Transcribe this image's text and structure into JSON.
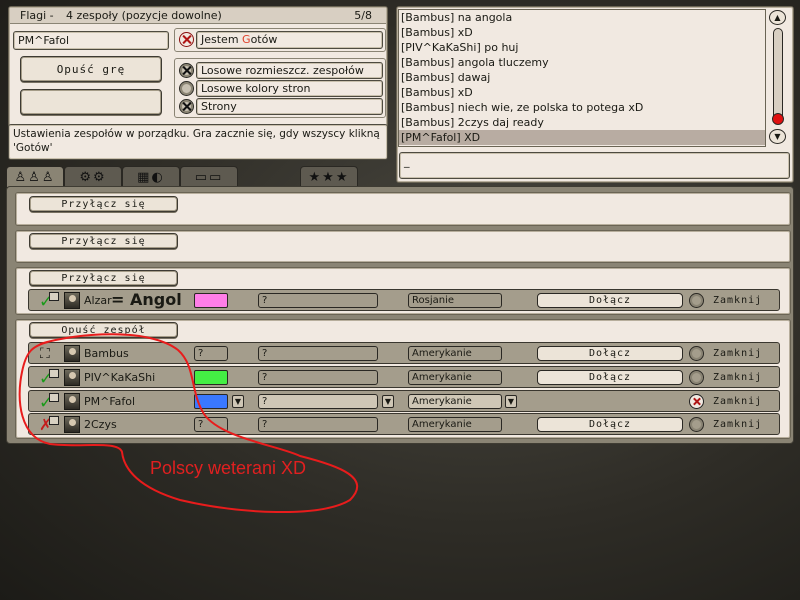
{
  "header": {
    "map_name": "Flagi -",
    "mode": "4 zespoły (pozycje dowolne)",
    "player_count": "5/8"
  },
  "left_panel": {
    "player_name": "PM^Fafol",
    "leave_game_label": "Opuść grę",
    "empty_button_label": "",
    "ready_label": "Jestem Gotów",
    "ready_highlight_char": "G",
    "options": [
      {
        "label": "Losowe rozmieszcz. zespołów",
        "checked": true
      },
      {
        "label": "Losowe kolory stron",
        "checked": false
      },
      {
        "label": "Strony",
        "checked": true
      }
    ],
    "status_message": "Ustawienia zespołów w porządku. Gra zacznie się, gdy wszyscy klikną 'Gotów'"
  },
  "chat": {
    "lines": [
      "[Bambus] na angola",
      "[Bambus] xD",
      "[PIV^KaKaShi] po huj",
      "[Bambus] angola tluczemy",
      "[Bambus] dawaj",
      "[Bambus] xD",
      "[Bambus] niech wie, ze polska to potega xD",
      "[Bambus] 2czys daj ready",
      "[PM^Fafol] XD"
    ],
    "input_value": "_"
  },
  "tabs": [
    {
      "icon": "players-tab-icon",
      "glyph": "♙♙♙",
      "active": true
    },
    {
      "icon": "settings-tab-icon",
      "glyph": "⚙⚙",
      "active": false
    },
    {
      "icon": "map-tab-icon",
      "glyph": "▦◐",
      "active": false
    },
    {
      "icon": "computers-tab-icon",
      "glyph": "▭▭",
      "active": false
    },
    {
      "icon": "stars-tab-icon",
      "glyph": "★★★",
      "active": false
    }
  ],
  "teams": [
    {
      "action_label": "Przyłącz się",
      "players": []
    },
    {
      "action_label": "Przyłącz się",
      "players": []
    },
    {
      "action_label": "Przyłącz się",
      "players": [
        {
          "name": "Alzar",
          "note": "= Angol",
          "status": "ready",
          "color": "#ff7ee8",
          "team_field": "?",
          "side": "Rosjanie",
          "join_label": "Dołącz",
          "close_label": "Zamknij",
          "close_checked": false
        }
      ]
    },
    {
      "action_label": "Opuść zespół",
      "players": [
        {
          "name": "Bambus",
          "note": "",
          "status": "host",
          "color": "",
          "team_field": "?",
          "side": "Amerykanie",
          "join_label": "Dołącz",
          "close_label": "Zamknij",
          "close_checked": false
        },
        {
          "name": "PIV^KaKaShi",
          "note": "",
          "status": "ready",
          "color": "#44ee44",
          "team_field": "?",
          "side": "Amerykanie",
          "join_label": "Dołącz",
          "close_label": "Zamknij",
          "close_checked": false
        },
        {
          "name": "PM^Fafol",
          "note": "",
          "status": "ready",
          "color": "#3a78ff",
          "team_field": "?",
          "side": "Amerykanie",
          "join_label": "",
          "close_label": "Zamknij",
          "close_checked": true
        },
        {
          "name": "2Czys",
          "note": "",
          "status": "not-ready",
          "color": "",
          "team_field": "?",
          "side": "Amerykanie",
          "join_label": "Dołącz",
          "close_label": "Zamknij",
          "close_checked": false
        }
      ]
    }
  ],
  "annotation": {
    "text": "Polscy weterani XD",
    "color": "#e02020"
  }
}
